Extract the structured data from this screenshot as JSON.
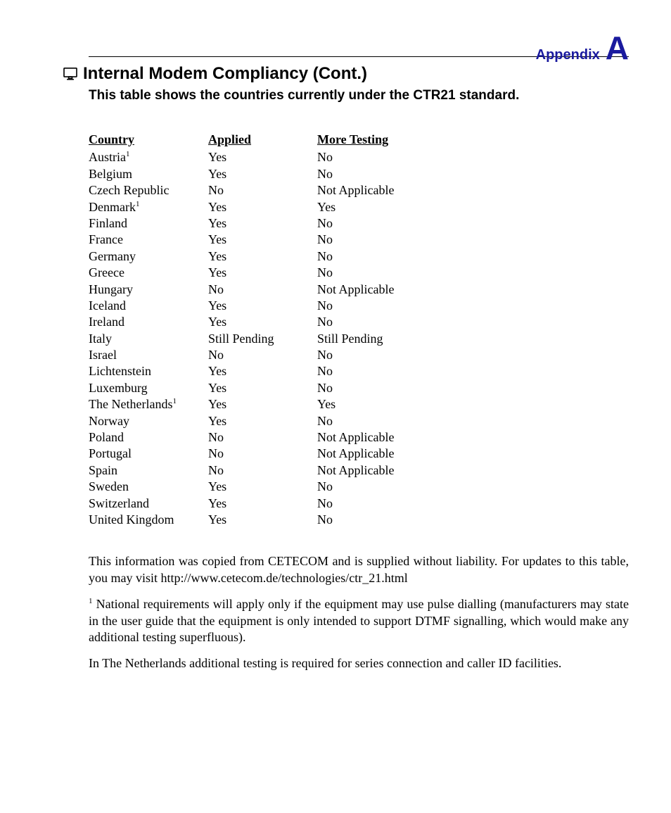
{
  "header": {
    "appendix_label": "Appendix",
    "appendix_letter": "A"
  },
  "title": "Internal Modem Compliancy (Cont.)",
  "subtitle": "This table shows the countries currently under the CTR21 standard.",
  "table": {
    "headers": {
      "country": "Country",
      "applied": "Applied",
      "more": "More Testing"
    },
    "rows": [
      {
        "country": "Austria",
        "sup": "1",
        "applied": "Yes",
        "more": "No"
      },
      {
        "country": "Belgium",
        "applied": "Yes",
        "more": "No"
      },
      {
        "country": "Czech Republic",
        "applied": "No",
        "more": "Not Applicable"
      },
      {
        "country": "Denmark",
        "sup": "1",
        "applied": "Yes",
        "more": "Yes"
      },
      {
        "country": "Finland",
        "applied": "Yes",
        "more": "No"
      },
      {
        "country": "France",
        "applied": "Yes",
        "more": "No"
      },
      {
        "country": "Germany",
        "applied": "Yes",
        "more": "No"
      },
      {
        "country": "Greece",
        "applied": "Yes",
        "more": "No"
      },
      {
        "country": "Hungary",
        "applied": "No",
        "more": "Not Applicable"
      },
      {
        "country": "Iceland",
        "applied": "Yes",
        "more": "No"
      },
      {
        "country": "Ireland",
        "applied": "Yes",
        "more": "No"
      },
      {
        "country": "Italy",
        "applied": "Still Pending",
        "more": "Still Pending"
      },
      {
        "country": "Israel",
        "applied": "No",
        "more": "No"
      },
      {
        "country": "Lichtenstein",
        "applied": "Yes",
        "more": "No"
      },
      {
        "country": "Luxemburg",
        "applied": "Yes",
        "more": "No"
      },
      {
        "country": "The Netherlands",
        "sup": "1",
        "applied": "Yes",
        "more": "Yes"
      },
      {
        "country": "Norway",
        "applied": "Yes",
        "more": "No"
      },
      {
        "country": "Poland",
        "applied": "No",
        "more": "Not Applicable"
      },
      {
        "country": "Portugal",
        "applied": "No",
        "more": "Not Applicable"
      },
      {
        "country": "Spain",
        "applied": "No",
        "more": "Not Applicable"
      },
      {
        "country": "Sweden",
        "applied": "Yes",
        "more": "No"
      },
      {
        "country": "Switzerland",
        "applied": "Yes",
        "more": "No"
      },
      {
        "country": "United Kingdom",
        "applied": "Yes",
        "more": "No"
      }
    ]
  },
  "paragraphs": {
    "p1": "This information was copied from CETECOM and is supplied without liability. For updates to this table, you may visit http://www.cetecom.de/technologies/ctr_21.html",
    "p2_sup": "1",
    "p2_rest": " National requirements will apply only if the equipment may use pulse dialling (manufacturers may state in the user guide that the equipment is only intended to support DTMF signalling, which would make any additional testing superfluous).",
    "p3": "In The Netherlands additional testing is required for series connection and caller ID facilities."
  }
}
